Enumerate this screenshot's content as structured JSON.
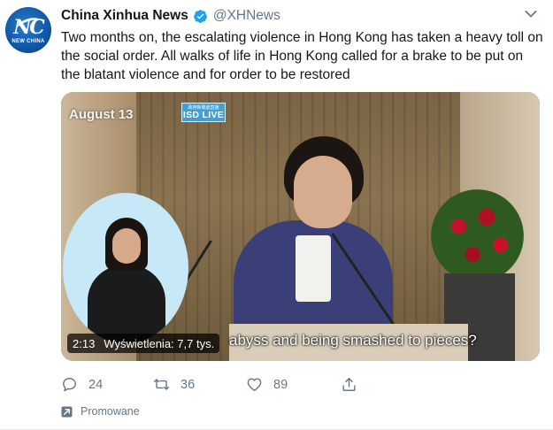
{
  "colors": {
    "accent": "#1da1f2",
    "secondary_text": "#657786",
    "primary_text": "#14171a"
  },
  "tweet": {
    "avatar": {
      "glyph": "NC",
      "caption": "NEW CHINA"
    },
    "display_name": "China Xinhua News",
    "verified_icon": "verified-badge-icon",
    "handle": "@XHNews",
    "menu_icon": "chevron-down-icon",
    "text": "Two months on, the escalating violence in Hong Kong has taken a heavy toll on the social order. All walks of life in Hong Kong called for a brake to be put on the blatant violence and for order to be restored",
    "video": {
      "date_overlay": "August 13",
      "logo_small": "政府新聞處直播",
      "logo": "ISD LIVE",
      "subtitle": "abyss and being smashed to pieces?",
      "duration": "2:13",
      "views": "Wyświetlenia: 7,7 tys."
    },
    "actions": {
      "reply": {
        "icon": "reply-icon",
        "count": "24"
      },
      "retweet": {
        "icon": "retweet-icon",
        "count": "36"
      },
      "like": {
        "icon": "heart-icon",
        "count": "89"
      },
      "share": {
        "icon": "share-icon"
      }
    },
    "promoted": {
      "icon": "promoted-arrow-icon",
      "label": "Promowane"
    }
  }
}
